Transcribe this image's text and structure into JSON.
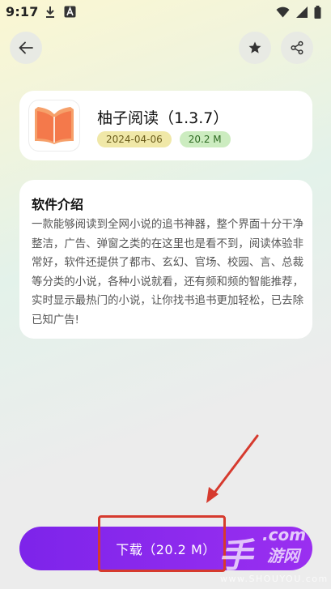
{
  "status_bar": {
    "time": "9:17",
    "icons": [
      "download-icon",
      "a-box-icon",
      "wifi-icon",
      "signal-icon",
      "battery-icon"
    ]
  },
  "toolbar": {
    "back_icon": "arrow-left-icon",
    "favorite_icon": "star-icon",
    "share_icon": "share-icon"
  },
  "app": {
    "icon": "open-book-icon",
    "name": "柚子阅读（1.3.7）",
    "date": "2024-04-06",
    "size": "20.2 M"
  },
  "intro": {
    "title": "软件介绍",
    "body": "一款能够阅读到全网小说的追书神器，整个界面十分干净整洁，广告、弹窗之类的在这里也是看不到，阅读体验非常好，软件还提供了都市、玄幻、官场、校园、言、总裁等分类的小说，各种小说就看，还有频和频的智能推荐，实时显示最热门的小说，让你找书追书更加轻松，已去除已知广告!"
  },
  "download": {
    "label": "下载（20.2 M）"
  },
  "watermark": {
    "com": ".com",
    "hand": "手",
    "cn": "游网",
    "url": "www.SHOUYOU.com"
  },
  "colors": {
    "accent": "#8a2be2",
    "annotation": "#d63a2e"
  }
}
